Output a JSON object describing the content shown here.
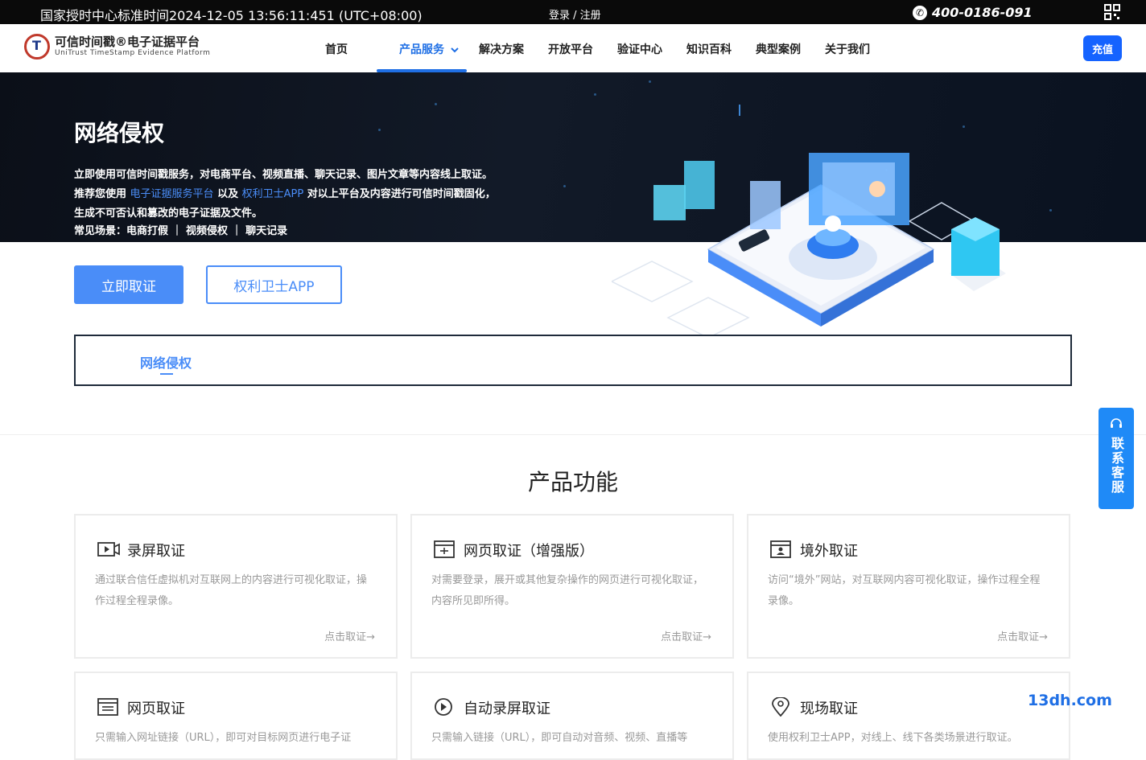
{
  "topbar": {
    "time": "国家授时中心标准时间2024-12-05 13:56:11:451 (UTC+08:00)",
    "auth": "登录 / 注册",
    "phone": "400-0186-091"
  },
  "logo": {
    "name": "可信时间戳®电子证据平台",
    "sub": "UniTrust TimeStamp Evidence Platform"
  },
  "nav": {
    "items": [
      {
        "label": "首页"
      },
      {
        "label": "产品服务"
      },
      {
        "label": "解决方案"
      },
      {
        "label": "开放平台"
      },
      {
        "label": "验证中心"
      },
      {
        "label": "知识百科"
      },
      {
        "label": "典型案例"
      },
      {
        "label": "关于我们"
      }
    ],
    "active": "产品服务",
    "recharge": "充值"
  },
  "hero": {
    "title": "网络侵权",
    "line1": "立即使用可信时间戳服务，对电商平台、视频直播、聊天记录、图片文章等内容线上取证。",
    "line2_a": "推荐您使用",
    "line2_link1": "电子证据服务平台",
    "line2_b": "以及",
    "line2_link2": "权利卫士APP",
    "line2_c": "对以上平台及内容进行可信时间戳固化，",
    "line3": "生成不可否认和篡改的电子证据及文件。",
    "scenes": "常见场景：电商打假 ｜ 视频侵权 ｜ 聊天记录"
  },
  "actions": {
    "primary": "立即取证",
    "secondary": "权利卫士APP"
  },
  "tab": {
    "label": "网络侵权"
  },
  "features": {
    "title": "产品功能",
    "cards": [
      {
        "icon": "video-icon",
        "title": "录屏取证",
        "text": "通过联合信任虚拟机对互联网上的内容进行可视化取证，操作过程全程录像。",
        "more": "点击取证→"
      },
      {
        "icon": "webpage-plus-icon",
        "title": "网页取证（增强版）",
        "text": "对需要登录，展开或其他复杂操作的网页进行可视化取证，内容所见即所得。",
        "more": "点击取证→"
      },
      {
        "icon": "webpage-user-icon",
        "title": "境外取证",
        "text": "访问“境外”网站，对互联网内容可视化取证，操作过程全程录像。",
        "more": "点击取证→"
      },
      {
        "icon": "webpage-icon",
        "title": "网页取证",
        "text": "只需输入网址链接（URL），即可对目标网页进行电子证",
        "more": ""
      },
      {
        "icon": "play-circle-icon",
        "title": "自动录屏取证",
        "text": "只需输入链接（URL），即可自动对音频、视频、直播等",
        "more": ""
      },
      {
        "icon": "location-pin-icon",
        "title": "现场取证",
        "text": "使用权利卫士APP，对线上、线下各类场景进行取证。",
        "more": ""
      }
    ]
  },
  "service": {
    "label": "联系客服"
  },
  "watermark": "13dh.com",
  "colors": {
    "brand": "#1f6fe5",
    "accent": "#4a8df8",
    "recharge": "#1563ff",
    "service": "#1f8af7"
  }
}
